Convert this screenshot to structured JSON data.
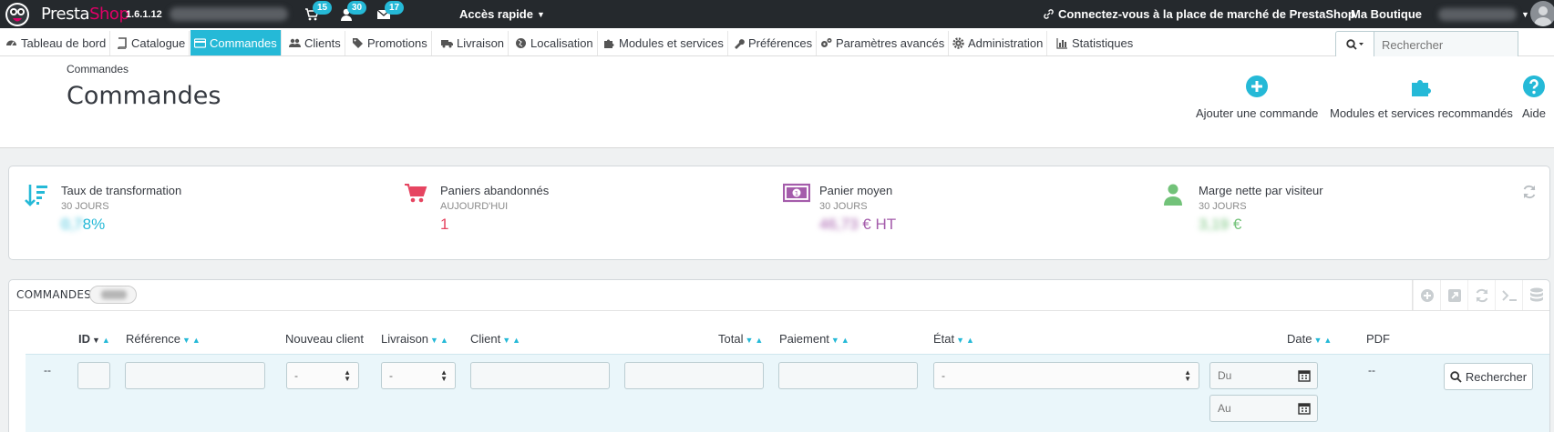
{
  "brand": {
    "name_part1": "Presta",
    "name_part2": "Shop",
    "version": "1.6.1.12"
  },
  "topbar": {
    "notifications": [
      {
        "icon": "cart-icon",
        "count": "15"
      },
      {
        "icon": "user-icon",
        "count": "30"
      },
      {
        "icon": "envelope-icon",
        "count": "17"
      }
    ],
    "quick_access": "Accès rapide",
    "marketplace": "Connectez-vous à la place de marché de PrestaShop",
    "my_shop": "Ma Boutique"
  },
  "nav": {
    "items": [
      {
        "label": "Tableau de bord",
        "icon": "dashboard-icon"
      },
      {
        "label": "Catalogue",
        "icon": "book-icon"
      },
      {
        "label": "Commandes",
        "icon": "credit-card-icon",
        "active": true
      },
      {
        "label": "Clients",
        "icon": "users-icon"
      },
      {
        "label": "Promotions",
        "icon": "tag-icon"
      },
      {
        "label": "Livraison",
        "icon": "truck-icon"
      },
      {
        "label": "Localisation",
        "icon": "globe-icon"
      },
      {
        "label": "Modules et services",
        "icon": "puzzle-icon"
      },
      {
        "label": "Préférences",
        "icon": "wrench-icon"
      },
      {
        "label": "Paramètres avancés",
        "icon": "cogs-icon"
      },
      {
        "label": "Administration",
        "icon": "cog-icon"
      },
      {
        "label": "Statistiques",
        "icon": "bar-chart-icon"
      }
    ],
    "search_placeholder": "Rechercher"
  },
  "page": {
    "breadcrumb": "Commandes",
    "title": "Commandes",
    "toolbar": [
      {
        "label": "Ajouter une commande",
        "icon": "plus-circle-icon"
      },
      {
        "label": "Modules et services recommandés",
        "icon": "puzzle-icon"
      },
      {
        "label": "Aide",
        "icon": "question-circle-icon"
      }
    ]
  },
  "kpis": [
    {
      "title": "Taux de transformation",
      "subtitle": "30 JOURS",
      "value_suffix": "%",
      "color": "#25b9d7",
      "icon": "sort-amount-icon"
    },
    {
      "title": "Paniers abandonnés",
      "subtitle": "AUJOURD'HUI",
      "value": "1",
      "color": "#e64561",
      "icon": "cart-icon"
    },
    {
      "title": "Panier moyen",
      "subtitle": "30 JOURS",
      "value_suffix": "€ HT",
      "color": "#a45cab",
      "icon": "money-icon"
    },
    {
      "title": "Marge nette par visiteur",
      "subtitle": "30 JOURS",
      "value_suffix": "€",
      "color": "#72c279",
      "icon": "user-icon"
    }
  ],
  "panel": {
    "title": "COMMANDES",
    "columns": [
      "ID",
      "Référence",
      "Nouveau client",
      "Livraison",
      "Client",
      "Total",
      "Paiement",
      "État",
      "Date",
      "PDF"
    ],
    "filters": {
      "dash_left": "--",
      "select_default": "-",
      "date_from_placeholder": "Du",
      "date_to_placeholder": "Au",
      "pdf_dash": "--",
      "search_button": "Rechercher"
    }
  }
}
